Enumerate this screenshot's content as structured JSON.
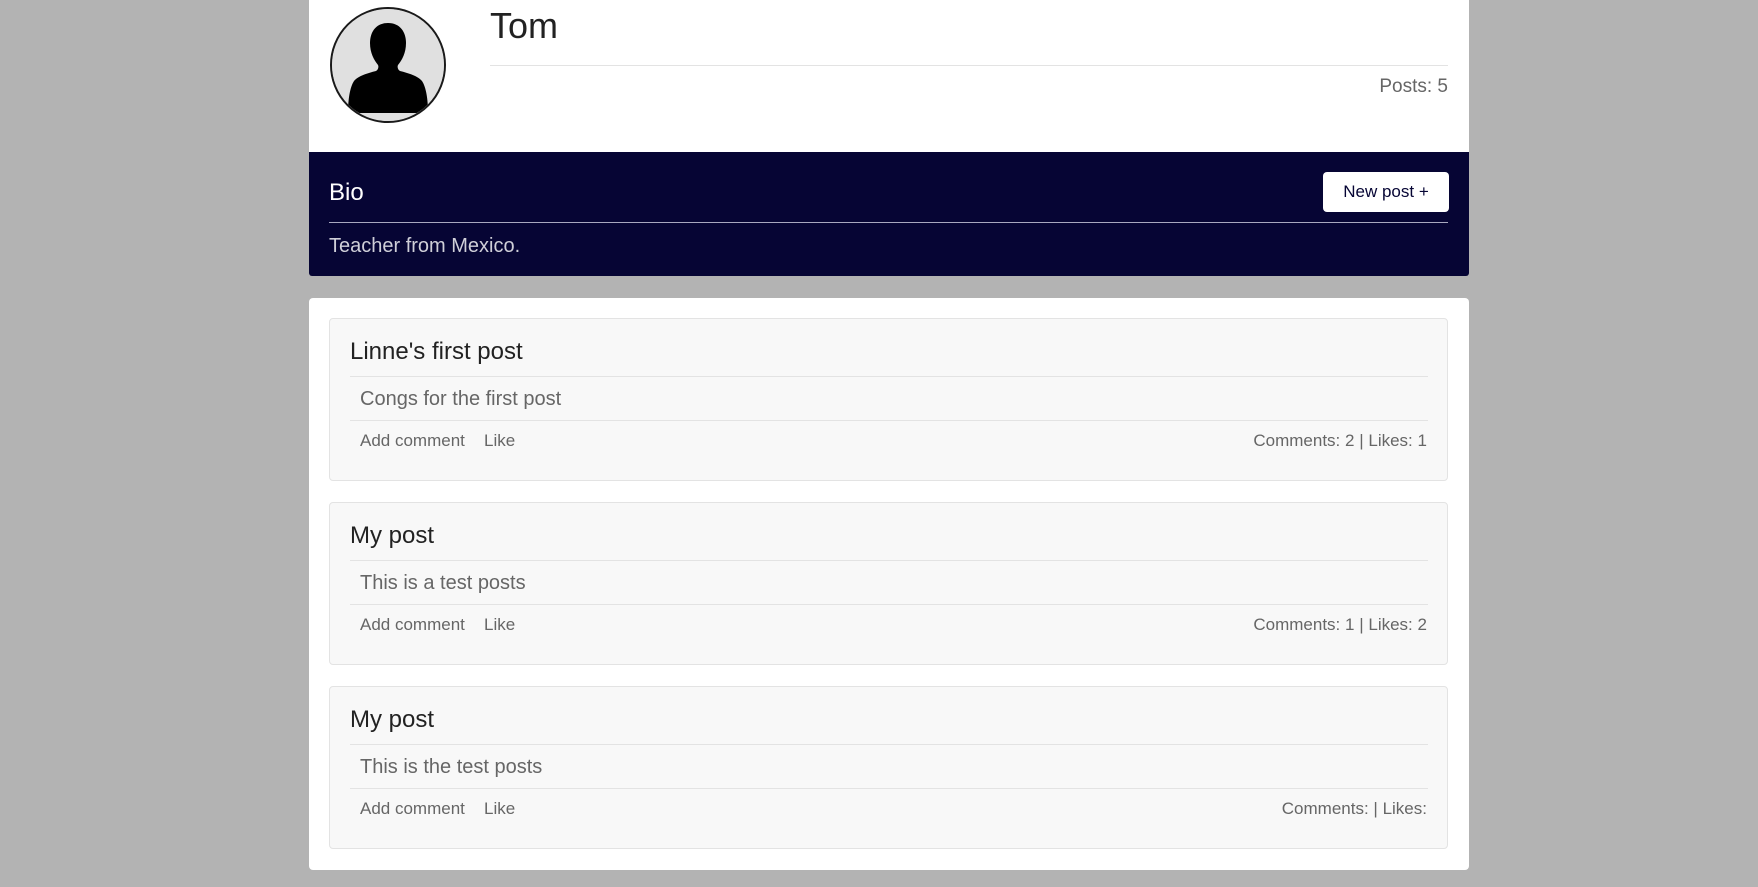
{
  "profile": {
    "name": "Tom",
    "posts_label": "Posts:",
    "posts_count": "5"
  },
  "bio": {
    "title": "Bio",
    "text": "Teacher from Mexico.",
    "new_post_label": "New post +"
  },
  "colors": {
    "page_background": "#b3b3b3",
    "bio_background": "#060534",
    "card_background": "#ffffff",
    "post_background": "#f8f8f8"
  },
  "icons": {
    "avatar": "user-silhouette-icon"
  },
  "posts": [
    {
      "title": "Linne's first post",
      "body": "Congs for the first post",
      "add_comment_label": "Add comment",
      "like_label": "Like",
      "comments_label": "Comments:",
      "comments_count": "2",
      "likes_label": "Likes:",
      "likes_count": "1"
    },
    {
      "title": "My post",
      "body": "This is a test posts",
      "add_comment_label": "Add comment",
      "like_label": "Like",
      "comments_label": "Comments:",
      "comments_count": "1",
      "likes_label": "Likes:",
      "likes_count": "2"
    },
    {
      "title": "My post",
      "body": "This is the test posts",
      "add_comment_label": "Add comment",
      "like_label": "Like",
      "comments_label": "Comments:",
      "comments_count": "",
      "likes_label": "Likes:",
      "likes_count": ""
    }
  ]
}
